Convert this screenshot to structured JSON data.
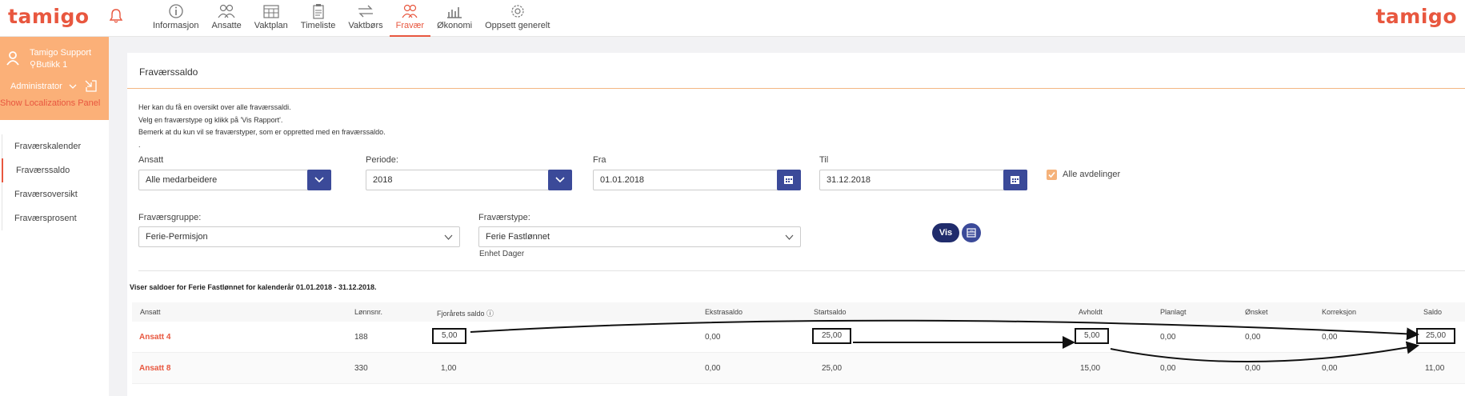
{
  "brand": {
    "logo": "tamigo",
    "accent": "#e8573f",
    "navy": "#3b4a99"
  },
  "nav": [
    {
      "label": "Informasjon",
      "icon": "info-icon"
    },
    {
      "label": "Ansatte",
      "icon": "people-icon"
    },
    {
      "label": "Vaktplan",
      "icon": "calendar-icon"
    },
    {
      "label": "Timeliste",
      "icon": "clipboard-icon"
    },
    {
      "label": "Vaktbørs",
      "icon": "swap-icon"
    },
    {
      "label": "Fravær",
      "icon": "absence-icon",
      "active": true
    },
    {
      "label": "Økonomi",
      "icon": "bar-chart-icon"
    },
    {
      "label": "Oppsett generelt",
      "icon": "gear-icon"
    }
  ],
  "user": {
    "name": "Tamigo Support",
    "store": "Butikk 1",
    "role": "Administrator",
    "localizations_link": "Show Localizations Panel"
  },
  "sidebar": {
    "items": [
      {
        "label": "Fraværskalender"
      },
      {
        "label": "Fraværssaldo",
        "active": true
      },
      {
        "label": "Fraværsoversikt"
      },
      {
        "label": "Fraværsprosent"
      }
    ]
  },
  "page": {
    "title": "Fraværssaldo",
    "intro": [
      "Her kan du få en oversikt over alle fraværssaldi.",
      "Velg en fraværstype og klikk på 'Vis Rapport'.",
      "Bemerk at du kun vil se fraværstyper, som er oppretted med en fraværssaldo.",
      "."
    ]
  },
  "filters": {
    "ansatt": {
      "label": "Ansatt",
      "value": "Alle medarbeidere"
    },
    "periode": {
      "label": "Periode:",
      "value": "2018"
    },
    "fra": {
      "label": "Fra",
      "value": "01.01.2018"
    },
    "til": {
      "label": "Til",
      "value": "31.12.2018"
    },
    "alle_avdelinger": {
      "label": "Alle avdelinger",
      "checked": true
    },
    "fravaersgruppe": {
      "label": "Fraværsgruppe:",
      "value": "Ferie-Permisjon"
    },
    "fravaerstype": {
      "label": "Fraværstype:",
      "value": "Ferie Fastlønnet"
    },
    "enhet": "Enhet Dager",
    "vis_label": "Vis",
    "export_icon": "excel-icon"
  },
  "table": {
    "summary": "Viser saldoer for Ferie Fastlønnet for kalenderår 01.01.2018 - 31.12.2018.",
    "headers": [
      "Ansatt",
      "Lønnsnr.",
      "Fjorårets saldo",
      "Ekstrasaldo",
      "Startsaldo",
      "Avholdt",
      "Planlagt",
      "Ønsket",
      "Korreksjon",
      "Saldo"
    ],
    "rows": [
      [
        "Ansatt 4",
        "188",
        "5,00",
        "0,00",
        "25,00",
        "5,00",
        "0,00",
        "0,00",
        "0,00",
        "25,00"
      ],
      [
        "Ansatt 8",
        "330",
        "1,00",
        "0,00",
        "25,00",
        "15,00",
        "0,00",
        "0,00",
        "0,00",
        "11,00"
      ]
    ]
  }
}
